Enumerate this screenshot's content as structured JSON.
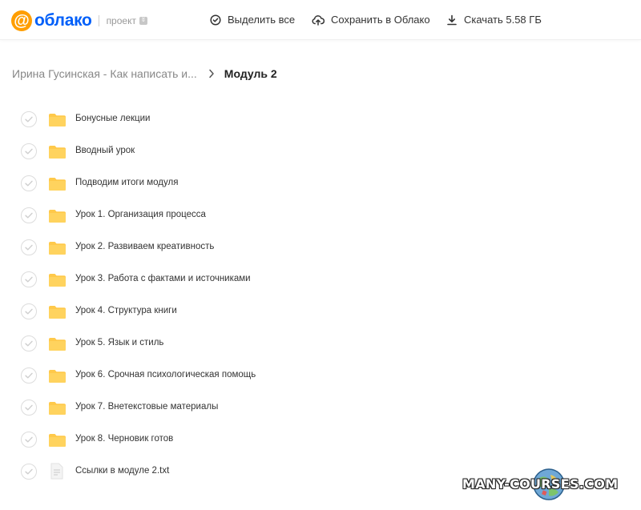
{
  "header": {
    "logo_text": "облако",
    "logo_sub": "проект",
    "select_all_label": "Выделить все",
    "save_label": "Сохранить в Облако",
    "download_label": "Скачать 5.58 ГБ"
  },
  "breadcrumb": {
    "parent": "Ирина Гусинская - Как написать и...",
    "current": "Модуль 2"
  },
  "files": [
    {
      "name": "Бонусные лекции",
      "type": "folder"
    },
    {
      "name": "Вводный урок",
      "type": "folder"
    },
    {
      "name": "Подводим итоги модуля",
      "type": "folder"
    },
    {
      "name": "Урок 1. Организация процесса",
      "type": "folder"
    },
    {
      "name": "Урок 2. Развиваем креативность",
      "type": "folder"
    },
    {
      "name": "Урок 3. Работа с фактами и источниками",
      "type": "folder"
    },
    {
      "name": "Урок 4. Структура книги",
      "type": "folder"
    },
    {
      "name": "Урок 5. Язык и стиль",
      "type": "folder"
    },
    {
      "name": "Урок 6. Срочная психологическая помощь",
      "type": "folder"
    },
    {
      "name": "Урок 7. Внетекстовые материалы",
      "type": "folder"
    },
    {
      "name": "Урок 8. Черновик готов",
      "type": "folder"
    },
    {
      "name": "Ссылки в модуле 2.txt",
      "type": "file"
    }
  ],
  "watermark": "MANY-COURSES.COM",
  "colors": {
    "brand_orange": "#ff9e00",
    "brand_blue": "#005ff9",
    "folder_yellow": "#ffc94a"
  },
  "icons": {
    "select_all": "check-circle-icon",
    "save": "cloud-upload-icon",
    "download": "download-icon",
    "breadcrumb_separator": "chevron-right-icon"
  }
}
